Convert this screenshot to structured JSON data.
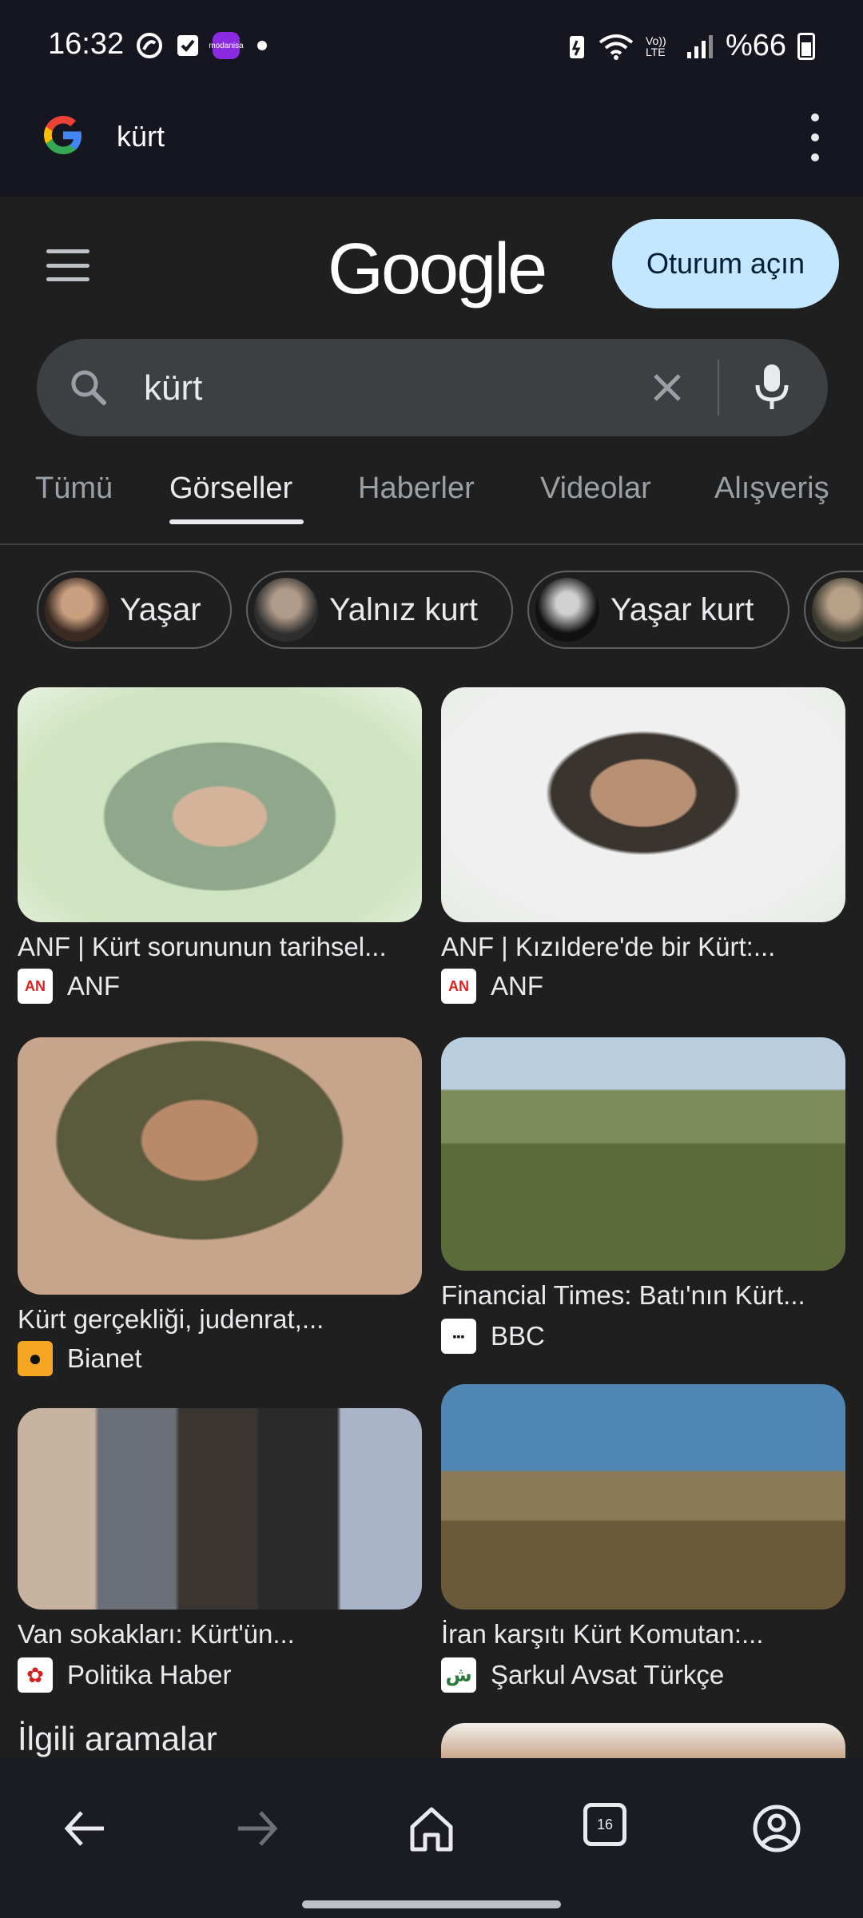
{
  "status_bar": {
    "time": "16:32",
    "battery": "%66",
    "app_badge_text": "modanisa",
    "volte_label": "Vo)) LTE"
  },
  "browser": {
    "query": "kürt"
  },
  "header": {
    "logo": "Google",
    "signin_label": "Oturum açın"
  },
  "search": {
    "value": "kürt"
  },
  "tabs": [
    {
      "label": "Tümü"
    },
    {
      "label": "Görseller"
    },
    {
      "label": "Haberler"
    },
    {
      "label": "Videolar"
    },
    {
      "label": "Alışveriş"
    }
  ],
  "chips": [
    {
      "label": "Yaşar"
    },
    {
      "label": "Yalnız kurt"
    },
    {
      "label": "Yaşar kurt"
    }
  ],
  "results": [
    {
      "title": "ANF | Kürt sorununun tarihsel...",
      "source": "ANF",
      "favicon": "AN"
    },
    {
      "title": "ANF | Kızıldere'de bir Kürt:...",
      "source": "ANF",
      "favicon": "AN"
    },
    {
      "title": "Kürt gerçekliği, judenrat,...",
      "source": "Bianet",
      "favicon": "●"
    },
    {
      "title": "Financial Times: Batı'nın Kürt...",
      "source": "BBC",
      "favicon": "▪▪▪"
    },
    {
      "title": "Van sokakları: Kürt'ün...",
      "source": "Politika Haber",
      "favicon": "✿"
    },
    {
      "title": "İran karşıtı Kürt Komutan:...",
      "source": "Şarkul Avsat Türkçe",
      "favicon": "ش"
    }
  ],
  "related": {
    "title": "İlgili aramalar"
  },
  "bottom_nav": {
    "tab_count": "16"
  },
  "colors": {
    "accent_signin": "#c2e7ff",
    "background": "#1f1f1f",
    "search_box": "#3c4043"
  }
}
